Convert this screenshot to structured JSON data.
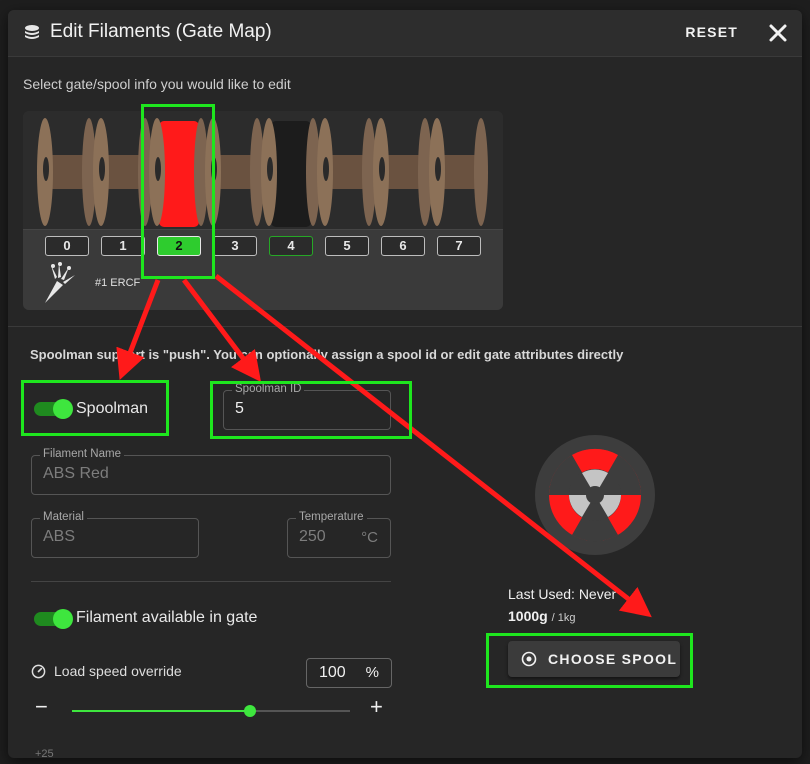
{
  "dialog": {
    "title": "Edit Filaments (Gate Map)",
    "reset_label": "RESET",
    "subtitle": "Select gate/spool info you would like to edit"
  },
  "gate_map": {
    "gates": [
      {
        "label": "0",
        "state": "empty",
        "color": "#7a6048"
      },
      {
        "label": "1",
        "state": "empty",
        "color": "#7a6048"
      },
      {
        "label": "2",
        "state": "selected",
        "color": "#ff1a1a"
      },
      {
        "label": "3",
        "state": "empty",
        "color": "#7a6048"
      },
      {
        "label": "4",
        "state": "loaded",
        "color": "#1c1c1c"
      },
      {
        "label": "5",
        "state": "empty",
        "color": "#7a6048"
      },
      {
        "label": "6",
        "state": "empty",
        "color": "#7a6048"
      },
      {
        "label": "7",
        "state": "empty",
        "color": "#7a6048"
      }
    ],
    "mmu_name": "#1 ERCF"
  },
  "spoolman": {
    "support_text": "Spoolman support is \"push\". You can optionally assign a spool id or edit gate attributes directly",
    "toggle_label": "Spoolman",
    "toggle_on": true,
    "id_label": "Spoolman ID",
    "id_value": "5"
  },
  "filament": {
    "name_label": "Filament Name",
    "name_value": "ABS Red",
    "material_label": "Material",
    "material_value": "ABS",
    "temp_label": "Temperature",
    "temp_value": "250",
    "temp_unit": "°C",
    "available_label": "Filament available in gate",
    "available_on": true
  },
  "speed": {
    "label": "Load speed override",
    "value": "100",
    "unit": "%",
    "slider_fraction": 0.64,
    "minus": "−",
    "plus": "+"
  },
  "spool_info": {
    "last_used": "Last Used: Never",
    "remaining": "1000g",
    "total": "/ 1kg",
    "choose_label": "CHOOSE SPOOL"
  },
  "colors": {
    "accent_green": "#3ee63e",
    "highlight_green": "#1ee61e",
    "arrow_red": "#ff1a1a",
    "spool_red": "#ff1a1a"
  },
  "background_fragments": {
    "bottom_left": "+25"
  }
}
